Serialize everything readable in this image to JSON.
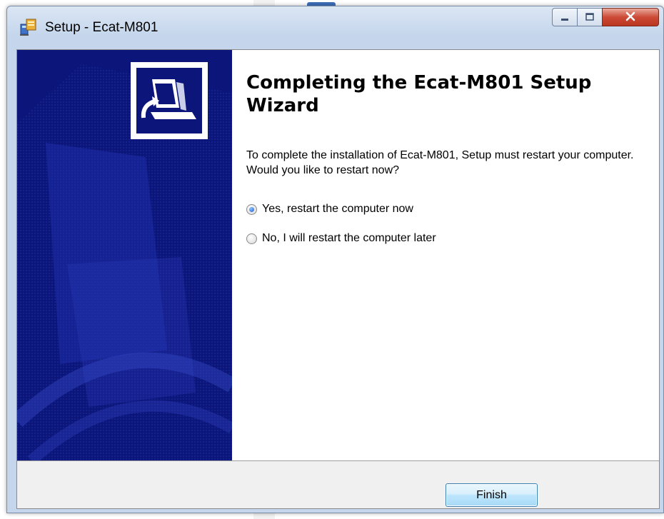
{
  "window": {
    "title": "Setup - Ecat-M801",
    "icon": "setup-installer-icon",
    "caption_buttons": [
      "minimize-icon",
      "maximize-icon",
      "close-icon"
    ]
  },
  "banner": {
    "icon": "computer-install-icon",
    "background_color": "#0b157a"
  },
  "main": {
    "heading": "Completing the Ecat-M801 Setup Wizard",
    "description": "To complete the installation of Ecat-M801, Setup must restart your computer. Would you like to restart now?",
    "options": [
      {
        "label": "Yes, restart the computer now",
        "selected": true
      },
      {
        "label": "No, I will restart the computer later",
        "selected": false
      }
    ]
  },
  "footer": {
    "finish_label": "Finish"
  },
  "colors": {
    "accent": "#3c7fb1",
    "close_button": "#c7422e"
  }
}
